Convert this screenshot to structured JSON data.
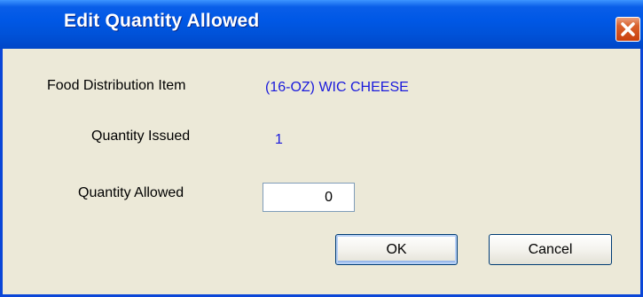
{
  "window": {
    "title": "Edit Quantity Allowed",
    "close_icon": "close-icon"
  },
  "form": {
    "item_label": "Food Distribution Item",
    "item_value": "(16-OZ) WIC CHEESE",
    "issued_label": "Quantity Issued",
    "issued_value": "1",
    "allowed_label": "Quantity Allowed",
    "allowed_value": "0"
  },
  "buttons": {
    "ok_label": "OK",
    "cancel_label": "Cancel"
  },
  "colors": {
    "titlebar": "#0058e6",
    "value_text": "#1a1adc",
    "close_button": "#d9602c"
  }
}
